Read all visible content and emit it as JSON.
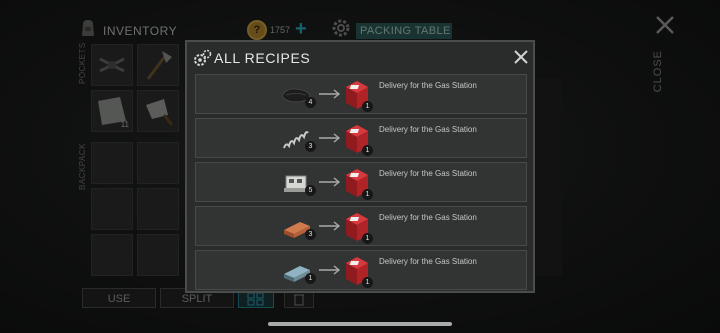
{
  "background": {
    "inventory_title": "INVENTORY",
    "coin_symbol": "?",
    "coins": "1757",
    "packing_table": "PACKING TABLE",
    "close_label": "CLOSE",
    "pockets_label": "POCKETS",
    "backpack_label": "BACKPACK",
    "slot_count": "11",
    "use_label": "USE",
    "split_label": "SPLIT"
  },
  "modal": {
    "title": "ALL RECIPES",
    "recipes": [
      {
        "ingredient": "tarp-icon",
        "ingredient_count": "4",
        "product": "gas-station-delivery-box-icon",
        "product_count": "1",
        "product_name": "Delivery for the Gas Station"
      },
      {
        "ingredient": "spring-icon",
        "ingredient_count": "3",
        "product": "gas-station-delivery-box-icon",
        "product_count": "1",
        "product_name": "Delivery for the Gas Station"
      },
      {
        "ingredient": "engine-part-icon",
        "ingredient_count": "5",
        "product": "gas-station-delivery-box-icon",
        "product_count": "1",
        "product_name": "Delivery for the Gas Station"
      },
      {
        "ingredient": "copper-bar-icon",
        "ingredient_count": "3",
        "product": "gas-station-delivery-box-icon",
        "product_count": "1",
        "product_name": "Delivery for the Gas Station"
      },
      {
        "ingredient": "steel-bar-icon",
        "ingredient_count": "1",
        "product": "gas-station-delivery-box-icon",
        "product_count": "1",
        "product_name": "Delivery for the Gas Station"
      }
    ]
  },
  "colors": {
    "accent": "#2fb5c9",
    "product_red": "#c8262b",
    "modal_bg": "#2a2c2c"
  }
}
